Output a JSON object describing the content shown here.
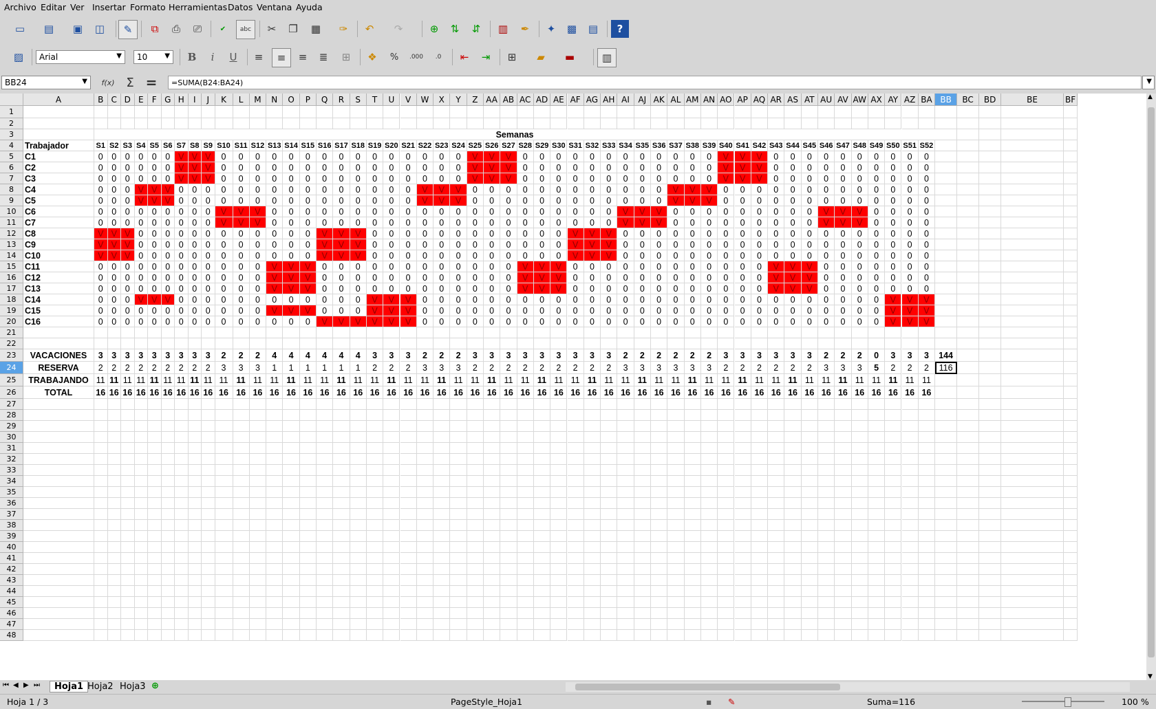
{
  "menu": [
    "Archivo",
    "Editar",
    "Ver",
    "Insertar",
    "Formato",
    "Herramientas",
    "Datos",
    "Ventana",
    "Ayuda"
  ],
  "toolbar": {
    "font_name": "Arial",
    "font_size": "10",
    "bold_label": "B",
    "italic_label": "i",
    "underline_label": "U",
    "percent_label": "%",
    "decimal_add_label": ".000",
    "decimal_remove_label": ".0"
  },
  "formula_bar": {
    "cell_ref": "BB24",
    "formula": "=SUMA(B24:BA24)",
    "func_label": "f(x)",
    "sum_label": "Σ",
    "equals_label": "="
  },
  "columns": [
    "A",
    "B",
    "C",
    "D",
    "E",
    "F",
    "G",
    "H",
    "I",
    "J",
    "K",
    "L",
    "M",
    "N",
    "O",
    "P",
    "Q",
    "R",
    "S",
    "T",
    "U",
    "V",
    "W",
    "X",
    "Y",
    "Z",
    "AA",
    "AB",
    "AC",
    "AD",
    "AE",
    "AF",
    "AG",
    "AH",
    "AI",
    "AJ",
    "AK",
    "AL",
    "AM",
    "AN",
    "AO",
    "AP",
    "AQ",
    "AR",
    "AS",
    "AT",
    "AU",
    "AV",
    "AW",
    "AX",
    "AY",
    "AZ",
    "BA",
    "BB",
    "BC",
    "BD",
    "BE",
    "BF"
  ],
  "rows": [
    1,
    2,
    3,
    4,
    5,
    6,
    7,
    8,
    9,
    10,
    11,
    12,
    13,
    14,
    15,
    16,
    17,
    18,
    19,
    20,
    21,
    22,
    23,
    24,
    25,
    26,
    27,
    28,
    29,
    30,
    31,
    32,
    33,
    34,
    35,
    36,
    37,
    38,
    39,
    40,
    41,
    42,
    43,
    44,
    45,
    46,
    47,
    48
  ],
  "sheet": {
    "title": "Semanas",
    "worker_header": "Trabajador",
    "weeks": [
      "S1",
      "S2",
      "S3",
      "S4",
      "S5",
      "S6",
      "S7",
      "S8",
      "S9",
      "S10",
      "S11",
      "S12",
      "S13",
      "S14",
      "S15",
      "S16",
      "S17",
      "S18",
      "S19",
      "S20",
      "S21",
      "S22",
      "S23",
      "S24",
      "S25",
      "S26",
      "S27",
      "S28",
      "S29",
      "S30",
      "S31",
      "S32",
      "S33",
      "S34",
      "S35",
      "S36",
      "S37",
      "S38",
      "S39",
      "S40",
      "S41",
      "S42",
      "S43",
      "S44",
      "S45",
      "S46",
      "S47",
      "S48",
      "S49",
      "S50",
      "S51",
      "S52"
    ],
    "workers": [
      {
        "name": "C1",
        "cells": [
          "0",
          "0",
          "0",
          "0",
          "0",
          "0",
          "V",
          "V",
          "V",
          "0",
          "0",
          "0",
          "0",
          "0",
          "0",
          "0",
          "0",
          "0",
          "0",
          "0",
          "0",
          "0",
          "0",
          "0",
          "V",
          "V",
          "V",
          "0",
          "0",
          "0",
          "0",
          "0",
          "0",
          "0",
          "0",
          "0",
          "0",
          "0",
          "0",
          "V",
          "V",
          "V",
          "0",
          "0",
          "0",
          "0",
          "0",
          "0",
          "0",
          "0",
          "0",
          "0"
        ]
      },
      {
        "name": "C2",
        "cells": [
          "0",
          "0",
          "0",
          "0",
          "0",
          "0",
          "V",
          "V",
          "V",
          "0",
          "0",
          "0",
          "0",
          "0",
          "0",
          "0",
          "0",
          "0",
          "0",
          "0",
          "0",
          "0",
          "0",
          "0",
          "V",
          "V",
          "V",
          "0",
          "0",
          "0",
          "0",
          "0",
          "0",
          "0",
          "0",
          "0",
          "0",
          "0",
          "0",
          "V",
          "V",
          "V",
          "0",
          "0",
          "0",
          "0",
          "0",
          "0",
          "0",
          "0",
          "0",
          "0"
        ]
      },
      {
        "name": "C3",
        "cells": [
          "0",
          "0",
          "0",
          "0",
          "0",
          "0",
          "V",
          "V",
          "V",
          "0",
          "0",
          "0",
          "0",
          "0",
          "0",
          "0",
          "0",
          "0",
          "0",
          "0",
          "0",
          "0",
          "0",
          "0",
          "V",
          "V",
          "V",
          "0",
          "0",
          "0",
          "0",
          "0",
          "0",
          "0",
          "0",
          "0",
          "0",
          "0",
          "0",
          "V",
          "V",
          "V",
          "0",
          "0",
          "0",
          "0",
          "0",
          "0",
          "0",
          "0",
          "0",
          "0"
        ]
      },
      {
        "name": "C4",
        "cells": [
          "0",
          "0",
          "0",
          "V",
          "V",
          "V",
          "0",
          "0",
          "0",
          "0",
          "0",
          "0",
          "0",
          "0",
          "0",
          "0",
          "0",
          "0",
          "0",
          "0",
          "0",
          "V",
          "V",
          "V",
          "0",
          "0",
          "0",
          "0",
          "0",
          "0",
          "0",
          "0",
          "0",
          "0",
          "0",
          "0",
          "V",
          "V",
          "V",
          "0",
          "0",
          "0",
          "0",
          "0",
          "0",
          "0",
          "0",
          "0",
          "0",
          "0",
          "0",
          "0"
        ]
      },
      {
        "name": "C5",
        "cells": [
          "0",
          "0",
          "0",
          "V",
          "V",
          "V",
          "0",
          "0",
          "0",
          "0",
          "0",
          "0",
          "0",
          "0",
          "0",
          "0",
          "0",
          "0",
          "0",
          "0",
          "0",
          "V",
          "V",
          "V",
          "0",
          "0",
          "0",
          "0",
          "0",
          "0",
          "0",
          "0",
          "0",
          "0",
          "0",
          "0",
          "V",
          "V",
          "V",
          "0",
          "0",
          "0",
          "0",
          "0",
          "0",
          "0",
          "0",
          "0",
          "0",
          "0",
          "0",
          "0"
        ]
      },
      {
        "name": "C6",
        "cells": [
          "0",
          "0",
          "0",
          "0",
          "0",
          "0",
          "0",
          "0",
          "0",
          "V",
          "V",
          "V",
          "0",
          "0",
          "0",
          "0",
          "0",
          "0",
          "0",
          "0",
          "0",
          "0",
          "0",
          "0",
          "0",
          "0",
          "0",
          "0",
          "0",
          "0",
          "0",
          "0",
          "0",
          "V",
          "V",
          "V",
          "0",
          "0",
          "0",
          "0",
          "0",
          "0",
          "0",
          "0",
          "0",
          "V",
          "V",
          "V",
          "0",
          "0",
          "0",
          "0"
        ]
      },
      {
        "name": "C7",
        "cells": [
          "0",
          "0",
          "0",
          "0",
          "0",
          "0",
          "0",
          "0",
          "0",
          "V",
          "V",
          "V",
          "0",
          "0",
          "0",
          "0",
          "0",
          "0",
          "0",
          "0",
          "0",
          "0",
          "0",
          "0",
          "0",
          "0",
          "0",
          "0",
          "0",
          "0",
          "0",
          "0",
          "0",
          "V",
          "V",
          "V",
          "0",
          "0",
          "0",
          "0",
          "0",
          "0",
          "0",
          "0",
          "0",
          "V",
          "V",
          "V",
          "0",
          "0",
          "0",
          "0"
        ]
      },
      {
        "name": "C8",
        "cells": [
          "V",
          "V",
          "V",
          "0",
          "0",
          "0",
          "0",
          "0",
          "0",
          "0",
          "0",
          "0",
          "0",
          "0",
          "0",
          "V",
          "V",
          "V",
          "0",
          "0",
          "0",
          "0",
          "0",
          "0",
          "0",
          "0",
          "0",
          "0",
          "0",
          "0",
          "V",
          "V",
          "V",
          "0",
          "0",
          "0",
          "0",
          "0",
          "0",
          "0",
          "0",
          "0",
          "0",
          "0",
          "0",
          "0",
          "0",
          "0",
          "0",
          "0",
          "0",
          "0"
        ]
      },
      {
        "name": "C9",
        "cells": [
          "V",
          "V",
          "V",
          "0",
          "0",
          "0",
          "0",
          "0",
          "0",
          "0",
          "0",
          "0",
          "0",
          "0",
          "0",
          "V",
          "V",
          "V",
          "0",
          "0",
          "0",
          "0",
          "0",
          "0",
          "0",
          "0",
          "0",
          "0",
          "0",
          "0",
          "V",
          "V",
          "V",
          "0",
          "0",
          "0",
          "0",
          "0",
          "0",
          "0",
          "0",
          "0",
          "0",
          "0",
          "0",
          "0",
          "0",
          "0",
          "0",
          "0",
          "0",
          "0"
        ]
      },
      {
        "name": "C10",
        "cells": [
          "V",
          "V",
          "V",
          "0",
          "0",
          "0",
          "0",
          "0",
          "0",
          "0",
          "0",
          "0",
          "0",
          "0",
          "0",
          "V",
          "V",
          "V",
          "0",
          "0",
          "0",
          "0",
          "0",
          "0",
          "0",
          "0",
          "0",
          "0",
          "0",
          "0",
          "V",
          "V",
          "V",
          "0",
          "0",
          "0",
          "0",
          "0",
          "0",
          "0",
          "0",
          "0",
          "0",
          "0",
          "0",
          "0",
          "0",
          "0",
          "0",
          "0",
          "0",
          "0"
        ]
      },
      {
        "name": "C11",
        "cells": [
          "0",
          "0",
          "0",
          "0",
          "0",
          "0",
          "0",
          "0",
          "0",
          "0",
          "0",
          "0",
          "V",
          "V",
          "V",
          "0",
          "0",
          "0",
          "0",
          "0",
          "0",
          "0",
          "0",
          "0",
          "0",
          "0",
          "0",
          "V",
          "V",
          "V",
          "0",
          "0",
          "0",
          "0",
          "0",
          "0",
          "0",
          "0",
          "0",
          "0",
          "0",
          "0",
          "V",
          "V",
          "V",
          "0",
          "0",
          "0",
          "0",
          "0",
          "0",
          "0"
        ]
      },
      {
        "name": "C12",
        "cells": [
          "0",
          "0",
          "0",
          "0",
          "0",
          "0",
          "0",
          "0",
          "0",
          "0",
          "0",
          "0",
          "V",
          "V",
          "V",
          "0",
          "0",
          "0",
          "0",
          "0",
          "0",
          "0",
          "0",
          "0",
          "0",
          "0",
          "0",
          "V",
          "V",
          "V",
          "0",
          "0",
          "0",
          "0",
          "0",
          "0",
          "0",
          "0",
          "0",
          "0",
          "0",
          "0",
          "V",
          "V",
          "V",
          "0",
          "0",
          "0",
          "0",
          "0",
          "0",
          "0"
        ]
      },
      {
        "name": "C13",
        "cells": [
          "0",
          "0",
          "0",
          "0",
          "0",
          "0",
          "0",
          "0",
          "0",
          "0",
          "0",
          "0",
          "V",
          "V",
          "V",
          "0",
          "0",
          "0",
          "0",
          "0",
          "0",
          "0",
          "0",
          "0",
          "0",
          "0",
          "0",
          "V",
          "V",
          "V",
          "0",
          "0",
          "0",
          "0",
          "0",
          "0",
          "0",
          "0",
          "0",
          "0",
          "0",
          "0",
          "V",
          "V",
          "V",
          "0",
          "0",
          "0",
          "0",
          "0",
          "0",
          "0"
        ]
      },
      {
        "name": "C14",
        "cells": [
          "0",
          "0",
          "0",
          "V",
          "V",
          "V",
          "0",
          "0",
          "0",
          "0",
          "0",
          "0",
          "0",
          "0",
          "0",
          "0",
          "0",
          "0",
          "V",
          "V",
          "V",
          "0",
          "0",
          "0",
          "0",
          "0",
          "0",
          "0",
          "0",
          "0",
          "0",
          "0",
          "0",
          "0",
          "0",
          "0",
          "0",
          "0",
          "0",
          "0",
          "0",
          "0",
          "0",
          "0",
          "0",
          "0",
          "0",
          "0",
          "0",
          "V",
          "V",
          "V"
        ]
      },
      {
        "name": "C15",
        "cells": [
          "0",
          "0",
          "0",
          "0",
          "0",
          "0",
          "0",
          "0",
          "0",
          "0",
          "0",
          "0",
          "V",
          "V",
          "V",
          "0",
          "0",
          "0",
          "V",
          "V",
          "V",
          "0",
          "0",
          "0",
          "0",
          "0",
          "0",
          "0",
          "0",
          "0",
          "0",
          "0",
          "0",
          "0",
          "0",
          "0",
          "0",
          "0",
          "0",
          "0",
          "0",
          "0",
          "0",
          "0",
          "0",
          "0",
          "0",
          "0",
          "0",
          "V",
          "V",
          "V"
        ]
      },
      {
        "name": "C16",
        "cells": [
          "0",
          "0",
          "0",
          "0",
          "0",
          "0",
          "0",
          "0",
          "0",
          "0",
          "0",
          "0",
          "0",
          "0",
          "0",
          "V",
          "V",
          "V",
          "V",
          "V",
          "V",
          "0",
          "0",
          "0",
          "0",
          "0",
          "0",
          "0",
          "0",
          "0",
          "0",
          "0",
          "0",
          "0",
          "0",
          "0",
          "0",
          "0",
          "0",
          "0",
          "0",
          "0",
          "0",
          "0",
          "0",
          "0",
          "0",
          "0",
          "0",
          "V",
          "V",
          "V"
        ]
      }
    ],
    "summary": [
      {
        "label": "VACACIONES",
        "values": [
          "3",
          "3",
          "3",
          "3",
          "3",
          "3",
          "3",
          "3",
          "3",
          "2",
          "2",
          "2",
          "4",
          "4",
          "4",
          "4",
          "4",
          "4",
          "3",
          "3",
          "3",
          "2",
          "2",
          "2",
          "3",
          "3",
          "3",
          "3",
          "3",
          "3",
          "3",
          "3",
          "3",
          "2",
          "2",
          "2",
          "2",
          "2",
          "2",
          "3",
          "3",
          "3",
          "3",
          "3",
          "3",
          "2",
          "2",
          "2",
          "0",
          "3",
          "3",
          "3"
        ],
        "total": "144"
      },
      {
        "label": "RESERVA",
        "values": [
          "2",
          "2",
          "2",
          "2",
          "2",
          "2",
          "2",
          "2",
          "2",
          "3",
          "3",
          "3",
          "1",
          "1",
          "1",
          "1",
          "1",
          "1",
          "2",
          "2",
          "2",
          "3",
          "3",
          "3",
          "2",
          "2",
          "2",
          "2",
          "2",
          "2",
          "2",
          "2",
          "2",
          "3",
          "3",
          "3",
          "3",
          "3",
          "3",
          "2",
          "2",
          "2",
          "2",
          "2",
          "2",
          "3",
          "3",
          "3",
          "5",
          "2",
          "2",
          "2"
        ],
        "total": "116"
      },
      {
        "label": "TRABAJANDO",
        "values": [
          "11",
          "11",
          "11",
          "11",
          "11",
          "11",
          "11",
          "11",
          "11",
          "11",
          "11",
          "11",
          "11",
          "11",
          "11",
          "11",
          "11",
          "11",
          "11",
          "11",
          "11",
          "11",
          "11",
          "11",
          "11",
          "11",
          "11",
          "11",
          "11",
          "11",
          "11",
          "11",
          "11",
          "11",
          "11",
          "11",
          "11",
          "11",
          "11",
          "11",
          "11",
          "11",
          "11",
          "11",
          "11",
          "11",
          "11",
          "11",
          "11",
          "11",
          "11",
          "11"
        ],
        "total": ""
      },
      {
        "label": "TOTAL",
        "values": [
          "16",
          "16",
          "16",
          "16",
          "16",
          "16",
          "16",
          "16",
          "16",
          "16",
          "16",
          "16",
          "16",
          "16",
          "16",
          "16",
          "16",
          "16",
          "16",
          "16",
          "16",
          "16",
          "16",
          "16",
          "16",
          "16",
          "16",
          "16",
          "16",
          "16",
          "16",
          "16",
          "16",
          "16",
          "16",
          "16",
          "16",
          "16",
          "16",
          "16",
          "16",
          "16",
          "16",
          "16",
          "16",
          "16",
          "16",
          "16",
          "16",
          "16",
          "16",
          "16"
        ],
        "total": ""
      }
    ]
  },
  "sheet_tabs": [
    "Hoja1",
    "Hoja2",
    "Hoja3"
  ],
  "active_tab": "Hoja1",
  "status": {
    "sheet": "Hoja 1 / 3",
    "page_style": "PageStyle_Hoja1",
    "sum": "Suma=116",
    "zoom": "100 %"
  },
  "colors": {
    "vacation_red": "#ff0000",
    "selection_blue": "#5aa2e6"
  }
}
